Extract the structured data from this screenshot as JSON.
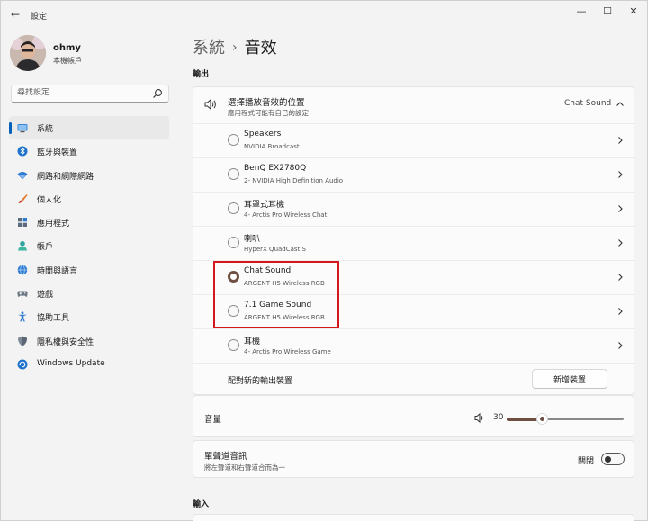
{
  "window": {
    "title": "設定",
    "back_glyph": "←",
    "min_glyph": "—",
    "max_glyph": "☐",
    "close_glyph": "✕"
  },
  "profile": {
    "name": "ohmy",
    "account": "本機帳戶"
  },
  "search": {
    "placeholder": "尋找設定"
  },
  "sidebar": {
    "items": [
      {
        "label": "系統",
        "icon": "monitor-icon",
        "active": true
      },
      {
        "label": "藍牙與裝置",
        "icon": "bluetooth-icon"
      },
      {
        "label": "網路和網際網路",
        "icon": "wifi-icon"
      },
      {
        "label": "個人化",
        "icon": "brush-icon"
      },
      {
        "label": "應用程式",
        "icon": "apps-icon"
      },
      {
        "label": "帳戶",
        "icon": "person-icon"
      },
      {
        "label": "時間與語言",
        "icon": "globe-clock-icon"
      },
      {
        "label": "遊戲",
        "icon": "gamepad-icon"
      },
      {
        "label": "協助工具",
        "icon": "accessibility-icon"
      },
      {
        "label": "隱私權與安全性",
        "icon": "shield-icon"
      },
      {
        "label": "Windows Update",
        "icon": "update-icon"
      }
    ]
  },
  "breadcrumb": {
    "parent": "系統",
    "separator": "›",
    "current": "音效"
  },
  "output": {
    "section_label": "輸出",
    "title": "選擇播放音效的位置",
    "subtitle": "應用程式可能有自己的設定",
    "selected_value": "Chat Sound",
    "devices": [
      {
        "name": "Speakers",
        "sub": "NVIDIA Broadcast",
        "selected": false
      },
      {
        "name": "BenQ EX2780Q",
        "sub": "2- NVIDIA High Definition Audio",
        "selected": false
      },
      {
        "name": "耳罩式耳機",
        "sub": "4- Arctis Pro Wireless Chat",
        "selected": false
      },
      {
        "name": "喇叭",
        "sub": "HyperX QuadCast S",
        "selected": false
      },
      {
        "name": "Chat Sound",
        "sub": "ARGENT H5 Wireless RGB",
        "selected": true
      },
      {
        "name": "7.1 Game Sound",
        "sub": "ARGENT H5 Wireless RGB",
        "selected": false
      },
      {
        "name": "耳機",
        "sub": "4- Arctis Pro Wireless Game",
        "selected": false
      }
    ],
    "pair_label": "配對新的輸出裝置",
    "add_button": "新增裝置"
  },
  "volume": {
    "label": "音量",
    "value": "30",
    "level": 0.3
  },
  "mono": {
    "title": "單聲道音訊",
    "subtitle": "將左聲道和右聲道合而為一",
    "state_label": "關閉",
    "on": false
  },
  "input": {
    "section_label": "輸入"
  },
  "colors": {
    "accent": "#6e4f42",
    "nav_indicator": "#005fb8",
    "highlight_box": "#d3171b"
  }
}
